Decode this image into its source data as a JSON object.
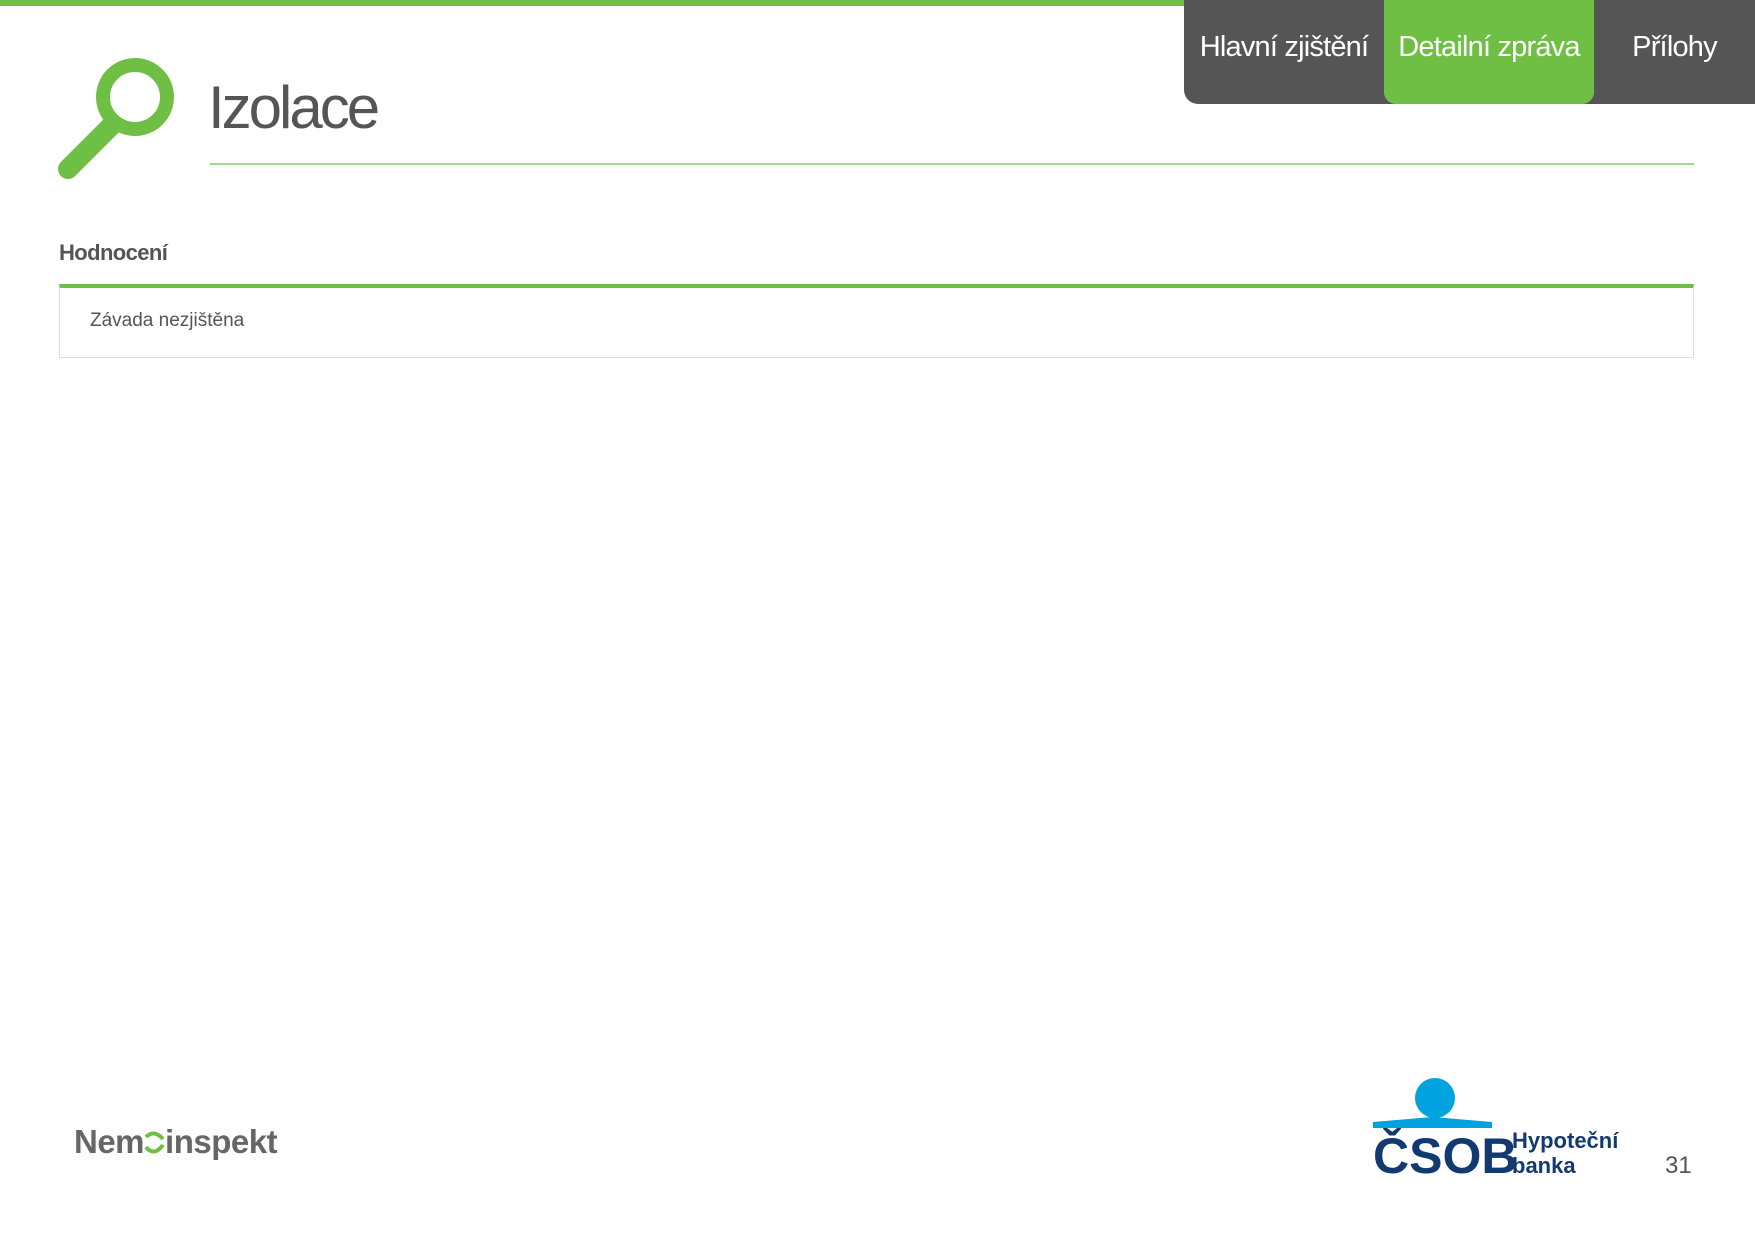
{
  "nav": {
    "tabs": [
      {
        "label": "Hlavní zjištění",
        "active": false
      },
      {
        "label": "Detailní zpráva",
        "active": true
      },
      {
        "label": "Přílohy",
        "active": false
      }
    ]
  },
  "header": {
    "title": "Izolace",
    "icon": "magnifier-icon"
  },
  "section": {
    "label": "Hodnocení",
    "value": "Závada nezjištěna"
  },
  "footer": {
    "left_logo": "Nemoinspekt",
    "right_logo_brand": "ČSOB",
    "right_logo_line1": "Hypoteční",
    "right_logo_line2": "banka",
    "page_number": "31"
  },
  "colors": {
    "accent": "#6fbf44",
    "nav_bg": "#555555",
    "text": "#555555",
    "csob_blue": "#00a3e0",
    "csob_navy": "#123a70"
  }
}
